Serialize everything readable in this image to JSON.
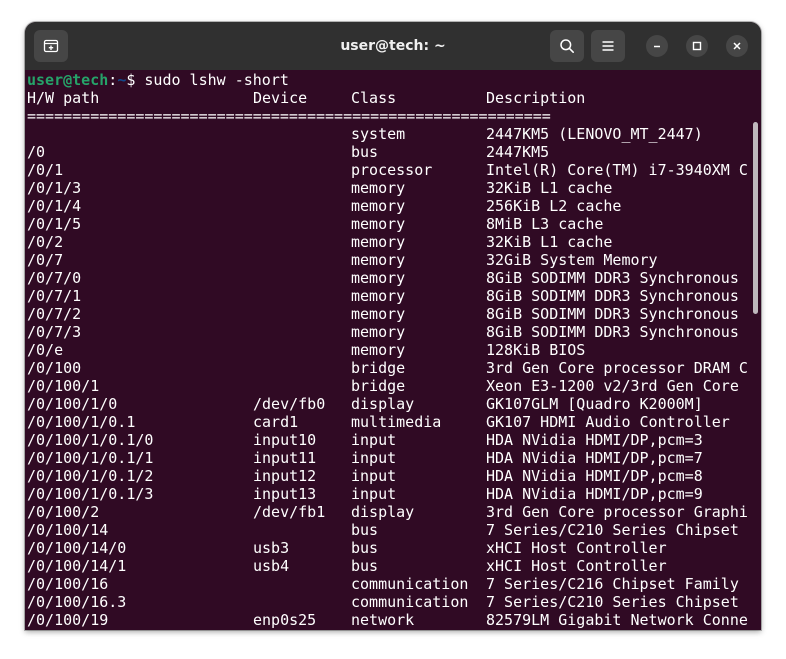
{
  "window": {
    "title": "user@tech: ~"
  },
  "icons": {
    "new_tab": "new-tab-icon",
    "search": "search-icon",
    "menu": "hamburger-menu-icon",
    "minimize": "minimize-icon",
    "maximize": "maximize-icon",
    "close": "close-icon"
  },
  "colors": {
    "terminal_bg": "#300a24",
    "titlebar_bg": "#303030",
    "prompt_user": "#26a269",
    "prompt_path": "#12488b"
  },
  "terminal": {
    "prompt_user": "user@tech",
    "prompt_sep": ":",
    "prompt_path": "~",
    "prompt_symbol": "$",
    "command": " sudo lshw -short",
    "header": {
      "path": "H/W path",
      "device": "Device",
      "class": "Class",
      "description": "Description"
    },
    "separator": "==========================================================",
    "rows": [
      {
        "path": "",
        "device": "",
        "class": "system",
        "description": "2447KM5 (LENOVO_MT_2447)"
      },
      {
        "path": "/0",
        "device": "",
        "class": "bus",
        "description": "2447KM5"
      },
      {
        "path": "/0/1",
        "device": "",
        "class": "processor",
        "description": "Intel(R) Core(TM) i7-3940XM C"
      },
      {
        "path": "/0/1/3",
        "device": "",
        "class": "memory",
        "description": "32KiB L1 cache"
      },
      {
        "path": "/0/1/4",
        "device": "",
        "class": "memory",
        "description": "256KiB L2 cache"
      },
      {
        "path": "/0/1/5",
        "device": "",
        "class": "memory",
        "description": "8MiB L3 cache"
      },
      {
        "path": "/0/2",
        "device": "",
        "class": "memory",
        "description": "32KiB L1 cache"
      },
      {
        "path": "/0/7",
        "device": "",
        "class": "memory",
        "description": "32GiB System Memory"
      },
      {
        "path": "/0/7/0",
        "device": "",
        "class": "memory",
        "description": "8GiB SODIMM DDR3 Synchronous"
      },
      {
        "path": "/0/7/1",
        "device": "",
        "class": "memory",
        "description": "8GiB SODIMM DDR3 Synchronous"
      },
      {
        "path": "/0/7/2",
        "device": "",
        "class": "memory",
        "description": "8GiB SODIMM DDR3 Synchronous"
      },
      {
        "path": "/0/7/3",
        "device": "",
        "class": "memory",
        "description": "8GiB SODIMM DDR3 Synchronous"
      },
      {
        "path": "/0/e",
        "device": "",
        "class": "memory",
        "description": "128KiB BIOS"
      },
      {
        "path": "/0/100",
        "device": "",
        "class": "bridge",
        "description": "3rd Gen Core processor DRAM C"
      },
      {
        "path": "/0/100/1",
        "device": "",
        "class": "bridge",
        "description": "Xeon E3-1200 v2/3rd Gen Core"
      },
      {
        "path": "/0/100/1/0",
        "device": "/dev/fb0",
        "class": "display",
        "description": "GK107GLM [Quadro K2000M]"
      },
      {
        "path": "/0/100/1/0.1",
        "device": "card1",
        "class": "multimedia",
        "description": "GK107 HDMI Audio Controller"
      },
      {
        "path": "/0/100/1/0.1/0",
        "device": "input10",
        "class": "input",
        "description": "HDA NVidia HDMI/DP,pcm=3"
      },
      {
        "path": "/0/100/1/0.1/1",
        "device": "input11",
        "class": "input",
        "description": "HDA NVidia HDMI/DP,pcm=7"
      },
      {
        "path": "/0/100/1/0.1/2",
        "device": "input12",
        "class": "input",
        "description": "HDA NVidia HDMI/DP,pcm=8"
      },
      {
        "path": "/0/100/1/0.1/3",
        "device": "input13",
        "class": "input",
        "description": "HDA NVidia HDMI/DP,pcm=9"
      },
      {
        "path": "/0/100/2",
        "device": "/dev/fb1",
        "class": "display",
        "description": "3rd Gen Core processor Graphi"
      },
      {
        "path": "/0/100/14",
        "device": "",
        "class": "bus",
        "description": "7 Series/C210 Series Chipset"
      },
      {
        "path": "/0/100/14/0",
        "device": "usb3",
        "class": "bus",
        "description": "xHCI Host Controller"
      },
      {
        "path": "/0/100/14/1",
        "device": "usb4",
        "class": "bus",
        "description": "xHCI Host Controller"
      },
      {
        "path": "/0/100/16",
        "device": "",
        "class": "communication",
        "description": "7 Series/C216 Chipset Family"
      },
      {
        "path": "/0/100/16.3",
        "device": "",
        "class": "communication",
        "description": "7 Series/C210 Series Chipset"
      },
      {
        "path": "/0/100/19",
        "device": "enp0s25",
        "class": "network",
        "description": "82579LM Gigabit Network Conne"
      }
    ]
  }
}
